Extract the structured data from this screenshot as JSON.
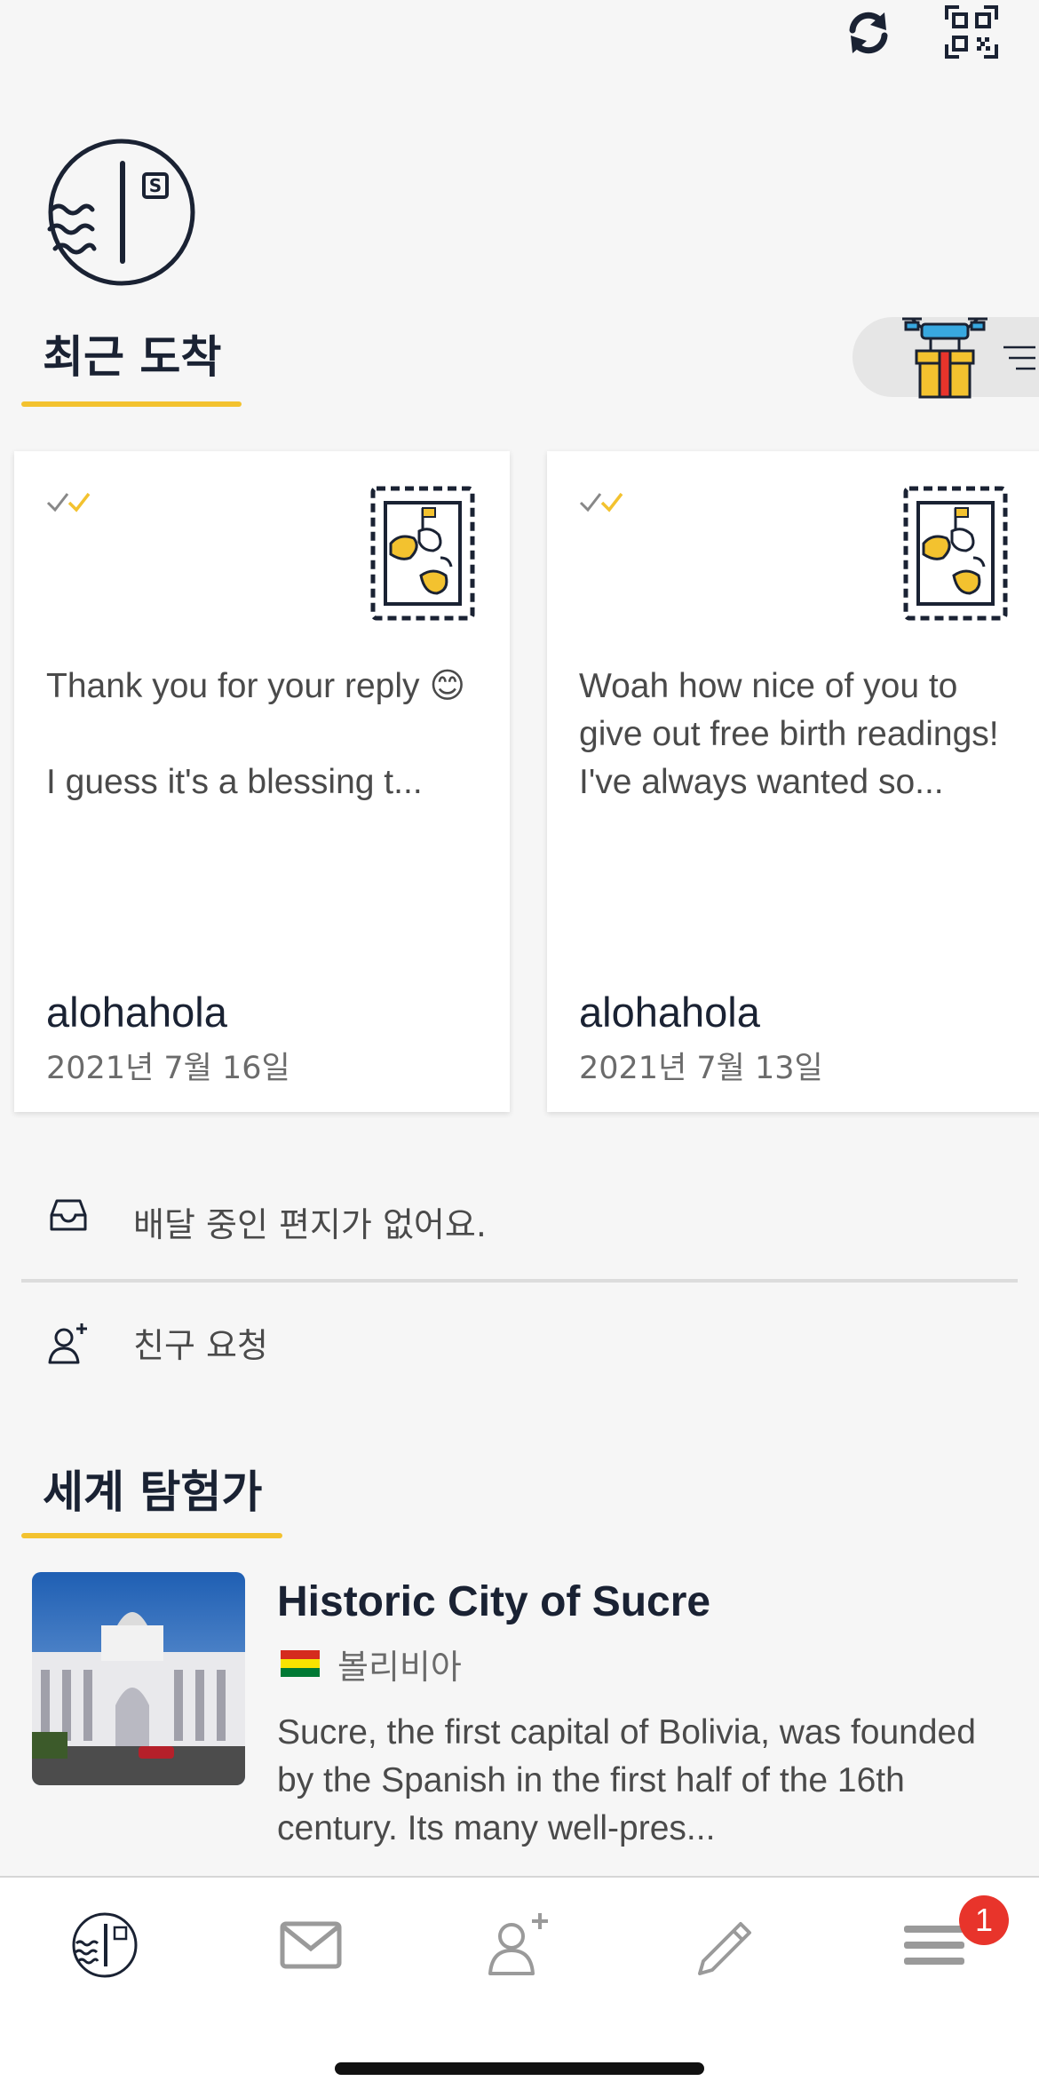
{
  "header": {
    "icons": [
      "refresh-icon",
      "qr-code-icon"
    ]
  },
  "recent": {
    "title": "최근 도착",
    "cards": [
      {
        "message": "Thank you for your reply 😊\n\nI guess it's a blessing t...",
        "author": "alohahola",
        "date": "2021년 7월 16일",
        "icons": [
          "double-check-icon",
          "world-map-stamp-icon"
        ]
      },
      {
        "message": "Woah how nice of you to give out free birth readings!\nI've always wanted so...",
        "author": "alohahola",
        "date": "2021년 7월 13일",
        "icons": [
          "double-check-icon",
          "world-map-stamp-icon"
        ]
      }
    ]
  },
  "status": {
    "no_delivery": "배달 중인 편지가 없어요.",
    "friend_requests": "친구 요청"
  },
  "explorer": {
    "title": "세계 탐험가",
    "item_title": "Historic City of Sucre",
    "country": "볼리비아",
    "description": "Sucre, the first capital of Bolivia, was founded by the Spanish in the first half of the 16th century. Its many well-pres..."
  },
  "tabbar": {
    "items": [
      "home-logo-icon",
      "mail-icon",
      "add-friend-icon",
      "pencil-icon",
      "menu-icon"
    ],
    "badge": "1"
  },
  "colors": {
    "accent": "#f3c22f",
    "navy": "#1a2233",
    "badge": "#e8342b"
  }
}
